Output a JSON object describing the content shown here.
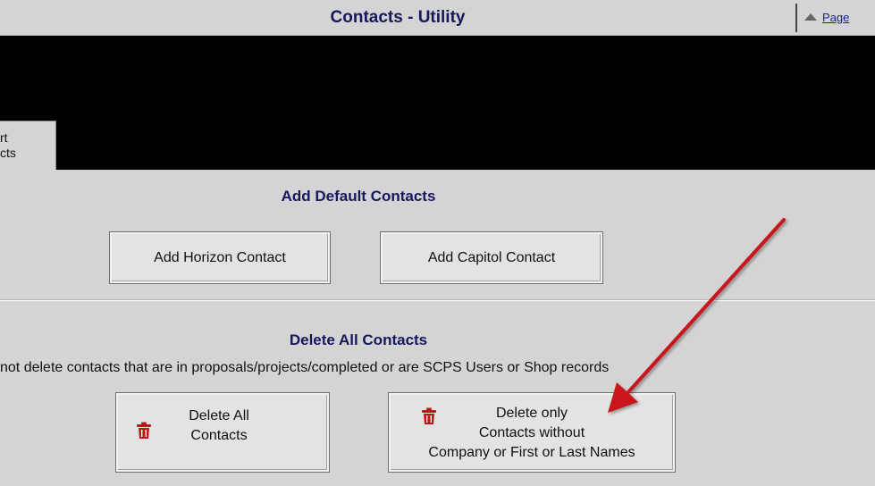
{
  "window": {
    "title": "Contacts - Utility",
    "page_menu_label": "Page"
  },
  "tab": {
    "line1": "rt",
    "line2": "cts"
  },
  "add_section": {
    "heading": "Add Default Contacts",
    "buttons": [
      {
        "label": "Add Horizon Contact"
      },
      {
        "label": "Add Capitol Contact"
      }
    ]
  },
  "delete_section": {
    "heading": "Delete All Contacts",
    "note": "not delete contacts that are in proposals/projects/completed or are SCPS Users or Shop records",
    "delete_all": {
      "line1": "Delete All",
      "line2": "Contacts"
    },
    "delete_only": {
      "line1": "Delete only",
      "line2": "Contacts without",
      "line3": "Company or First or Last Names"
    }
  },
  "icons": {
    "delete": "trash-icon",
    "page_menu": "triangle-up-icon"
  },
  "colors": {
    "heading": "#16185e",
    "link": "#1a1aa6",
    "panel": "#d4d4d4",
    "trash": "#c0141b",
    "annotation_arrow": "#c8191e"
  }
}
